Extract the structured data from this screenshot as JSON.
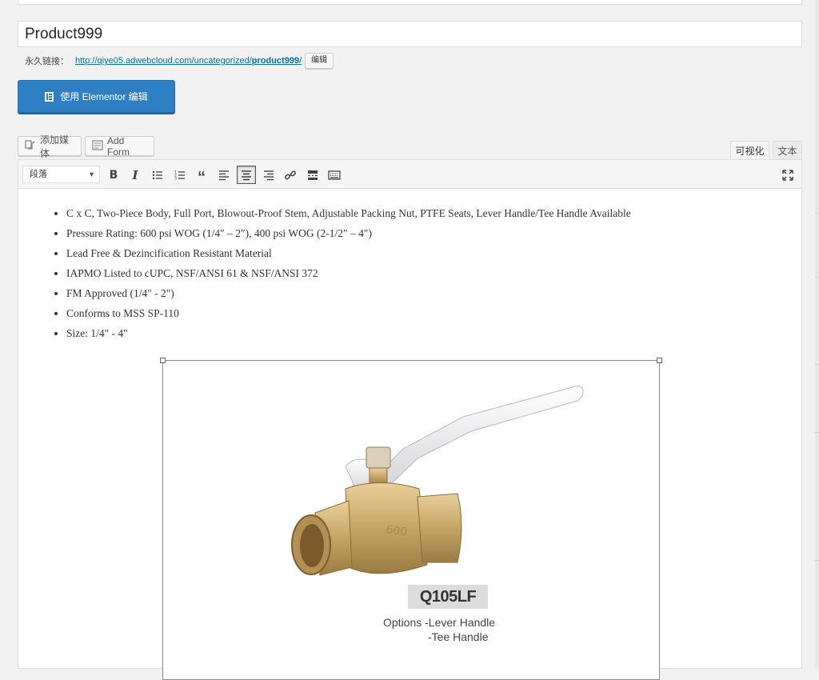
{
  "post": {
    "title": "Product999",
    "permalink_label": "永久链接：",
    "permalink_url_base": "http://qiye05.adwebcloud.com/uncategorized/",
    "permalink_slug": "product999",
    "permalink_url_end": "/",
    "edit_slug_label": "编辑"
  },
  "elementor": {
    "button_label": "使用 Elementor 编辑"
  },
  "media_buttons": {
    "add_media_label": "添加媒体",
    "add_form_label": "Add Form"
  },
  "editor_tabs": {
    "visual_label": "可视化",
    "text_label": "文本",
    "active": "visual"
  },
  "toolbar": {
    "format_value": "段落",
    "buttons": [
      "bold-icon",
      "italic-icon",
      "bullet-list-icon",
      "numbered-list-icon",
      "blockquote-icon",
      "align-left-icon",
      "align-center-icon",
      "align-right-icon",
      "link-icon",
      "read-more-icon",
      "toolbar-toggle-icon",
      "fullscreen-icon"
    ],
    "pressed": "align-center-icon"
  },
  "content": {
    "bullets": [
      "C x C, Two-Piece Body, Full Port, Blowout-Proof Stem, Adjustable Packing Nut, PTFE Seats, Lever Handle/Tee Handle Available",
      "Pressure Rating: 600 psi WOG (1/4″ – 2″), 400 psi WOG (2-1/2″ – 4″)",
      "Lead Free & Dezincification Resistant Material",
      "IAPMO Listed to cUPC, NSF/ANSI 61 & NSF/ANSI 372",
      "FM Approved (1/4\" - 2\")",
      "Conforms to MSS SP-110",
      "Size: 1/4\" - 4\""
    ],
    "image": {
      "model_label": "Q105LF",
      "options_line1": "Options  -Lever Handle",
      "options_line2": "-Tee Handle"
    }
  },
  "colors": {
    "elementor_blue": "#2e7fc4",
    "link_blue": "#0073aa",
    "brass": "#c9a96a"
  }
}
